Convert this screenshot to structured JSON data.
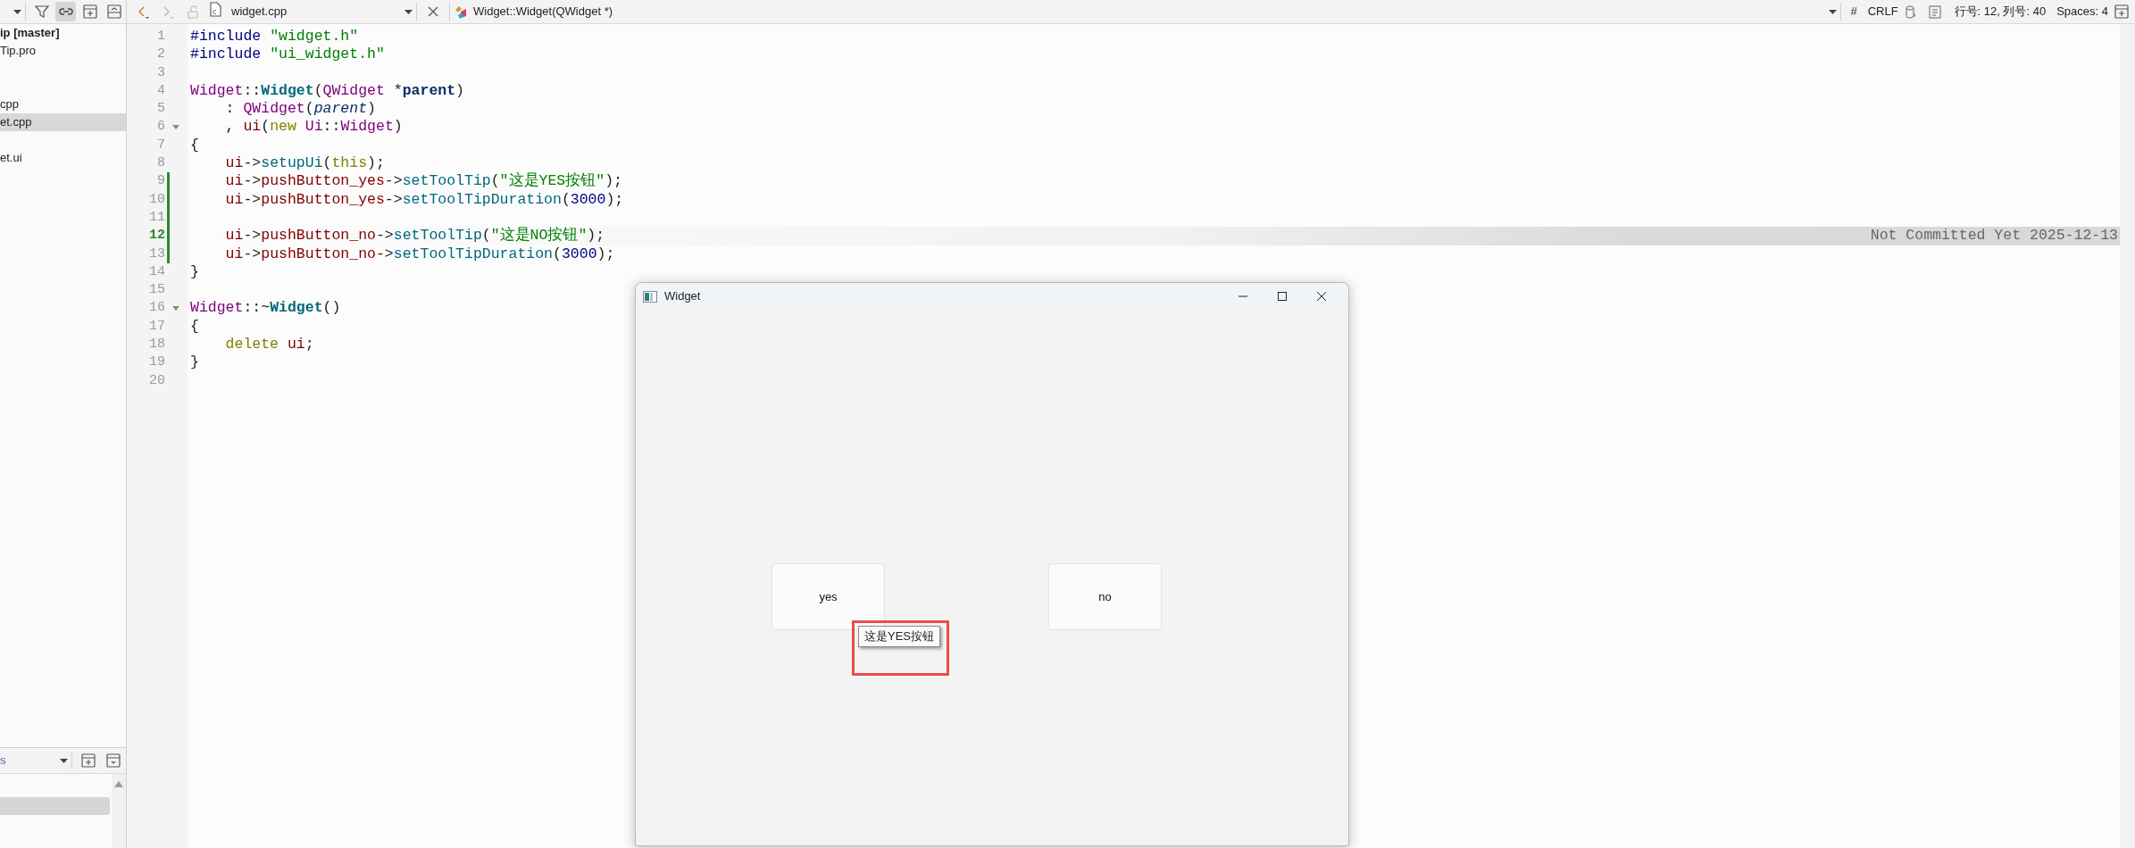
{
  "sidebar_toolbar": {
    "buttons": [
      {
        "kind": "filter",
        "on": false
      },
      {
        "kind": "link",
        "on": true
      },
      {
        "kind": "split",
        "on": false
      },
      {
        "kind": "collapse",
        "on": false
      }
    ]
  },
  "project_tree": {
    "items": [
      {
        "label": "ip [master]",
        "kind": "project",
        "selected": false
      },
      {
        "label": "Tip.pro",
        "kind": "file",
        "selected": false
      },
      {
        "selected": false
      },
      {
        "selected": false
      },
      {
        "label": "cpp",
        "kind": "file",
        "selected": false
      },
      {
        "label": "et.cpp",
        "kind": "file",
        "selected": true
      },
      {
        "selected": false
      },
      {
        "label": "et.ui",
        "kind": "file",
        "selected": false
      }
    ]
  },
  "bottom_pane": {
    "title": "s",
    "rows": [
      {
        "selected": false
      },
      {
        "selected": true
      }
    ]
  },
  "editor_toolbar": {
    "nav": [
      {
        "kind": "back",
        "disabled": false
      },
      {
        "kind": "forward",
        "disabled": true
      }
    ],
    "file": "widget.cpp",
    "symbol": "Widget::Widget(QWidget *)",
    "hash": "#",
    "line_ending": "CRLF",
    "position": "行号: 12, 列号: 40",
    "indent": "Spaces: 4"
  },
  "code": {
    "lines": [
      {
        "number": "1",
        "tokens": [
          {
            "text": "#include ",
            "kind": "preproc"
          },
          {
            "text": "\"widget.h\"",
            "kind": "string"
          }
        ]
      },
      {
        "number": "2",
        "tokens": [
          {
            "text": "#include ",
            "kind": "preproc"
          },
          {
            "text": "\"ui_widget.h\"",
            "kind": "string"
          }
        ]
      },
      {
        "number": "3"
      },
      {
        "number": "4",
        "tokens": [
          {
            "text": "Widget",
            "kind": "type"
          },
          {
            "text": "::",
            "kind": "plain"
          },
          {
            "text": "Widget",
            "kind": "func"
          },
          {
            "text": "(",
            "kind": "plain"
          },
          {
            "text": "QWidget",
            "kind": "type"
          },
          {
            "text": " *",
            "kind": "plain"
          },
          {
            "text": "parent",
            "kind": "param"
          },
          {
            "text": ")",
            "kind": "plain"
          }
        ]
      },
      {
        "number": "5",
        "tokens": [
          {
            "text": "    : ",
            "kind": "plain"
          },
          {
            "text": "QWidget",
            "kind": "type"
          },
          {
            "text": "(",
            "kind": "plain"
          },
          {
            "text": "parent",
            "kind": "param_italic"
          },
          {
            "text": ")",
            "kind": "plain"
          }
        ]
      },
      {
        "number": "6",
        "foldable": true,
        "tokens": [
          {
            "text": "    , ",
            "kind": "plain"
          },
          {
            "text": "ui",
            "kind": "member"
          },
          {
            "text": "(",
            "kind": "plain"
          },
          {
            "text": "new ",
            "kind": "keyword"
          },
          {
            "text": "Ui",
            "kind": "type"
          },
          {
            "text": "::",
            "kind": "plain"
          },
          {
            "text": "Widget",
            "kind": "type"
          },
          {
            "text": ")",
            "kind": "plain"
          }
        ]
      },
      {
        "number": "7",
        "tokens": [
          {
            "text": "{",
            "kind": "plain"
          }
        ]
      },
      {
        "number": "8",
        "tokens": [
          {
            "text": "    ui",
            "kind": "member"
          },
          {
            "text": "->",
            "kind": "plain"
          },
          {
            "text": "setupUi",
            "kind": "method"
          },
          {
            "text": "(",
            "kind": "plain"
          },
          {
            "text": "this",
            "kind": "keyword"
          },
          {
            "text": ");",
            "kind": "plain"
          }
        ]
      },
      {
        "number": "9",
        "changed": true,
        "tokens": [
          {
            "text": "    ui",
            "kind": "member"
          },
          {
            "text": "->",
            "kind": "plain"
          },
          {
            "text": "pushButton_yes",
            "kind": "member"
          },
          {
            "text": "->",
            "kind": "plain"
          },
          {
            "text": "setToolTip",
            "kind": "method"
          },
          {
            "text": "(",
            "kind": "plain"
          },
          {
            "text": "\"这是YES按钮\"",
            "kind": "string"
          },
          {
            "text": ");",
            "kind": "plain"
          }
        ]
      },
      {
        "number": "10",
        "changed": true,
        "tokens": [
          {
            "text": "    ui",
            "kind": "member"
          },
          {
            "text": "->",
            "kind": "plain"
          },
          {
            "text": "pushButton_yes",
            "kind": "member"
          },
          {
            "text": "->",
            "kind": "plain"
          },
          {
            "text": "setToolTipDuration",
            "kind": "method"
          },
          {
            "text": "(",
            "kind": "plain"
          },
          {
            "text": "3000",
            "kind": "number"
          },
          {
            "text": ");",
            "kind": "plain"
          }
        ]
      },
      {
        "number": "11",
        "changed": true
      },
      {
        "number": "12",
        "changed": true,
        "current": true,
        "blame": "Not Committed Yet 2025-12-13",
        "tokens": [
          {
            "text": "    ui",
            "kind": "member"
          },
          {
            "text": "->",
            "kind": "plain"
          },
          {
            "text": "pushButton_no",
            "kind": "member"
          },
          {
            "text": "->",
            "kind": "plain"
          },
          {
            "text": "setToolTip",
            "kind": "method"
          },
          {
            "text": "(",
            "kind": "plain"
          },
          {
            "text": "\"这是NO按钮\"",
            "kind": "string"
          },
          {
            "text": ");",
            "kind": "plain"
          }
        ]
      },
      {
        "number": "13",
        "changed": true,
        "tokens": [
          {
            "text": "    ui",
            "kind": "member"
          },
          {
            "text": "->",
            "kind": "plain"
          },
          {
            "text": "pushButton_no",
            "kind": "member"
          },
          {
            "text": "->",
            "kind": "plain"
          },
          {
            "text": "setToolTipDuration",
            "kind": "method"
          },
          {
            "text": "(",
            "kind": "plain"
          },
          {
            "text": "3000",
            "kind": "number"
          },
          {
            "text": ");",
            "kind": "plain"
          }
        ]
      },
      {
        "number": "14",
        "tokens": [
          {
            "text": "}",
            "kind": "plain"
          }
        ]
      },
      {
        "number": "15"
      },
      {
        "number": "16",
        "foldable": true,
        "tokens": [
          {
            "text": "Widget",
            "kind": "type"
          },
          {
            "text": "::~",
            "kind": "plain"
          },
          {
            "text": "Widget",
            "kind": "func"
          },
          {
            "text": "()",
            "kind": "plain"
          }
        ]
      },
      {
        "number": "17",
        "tokens": [
          {
            "text": "{",
            "kind": "plain"
          }
        ]
      },
      {
        "number": "18",
        "tokens": [
          {
            "text": "    delete ",
            "kind": "keyword"
          },
          {
            "text": "ui",
            "kind": "member"
          },
          {
            "text": ";",
            "kind": "plain"
          }
        ]
      },
      {
        "number": "19",
        "tokens": [
          {
            "text": "}",
            "kind": "plain"
          }
        ]
      },
      {
        "number": "20"
      }
    ]
  },
  "app_window": {
    "title": "Widget",
    "buttons": [
      {
        "label": "yes"
      },
      {
        "label": "no"
      }
    ],
    "tooltip": {
      "text": "这是YES按钮"
    },
    "annotations": [
      {
        "kind": "rectangle"
      }
    ]
  }
}
